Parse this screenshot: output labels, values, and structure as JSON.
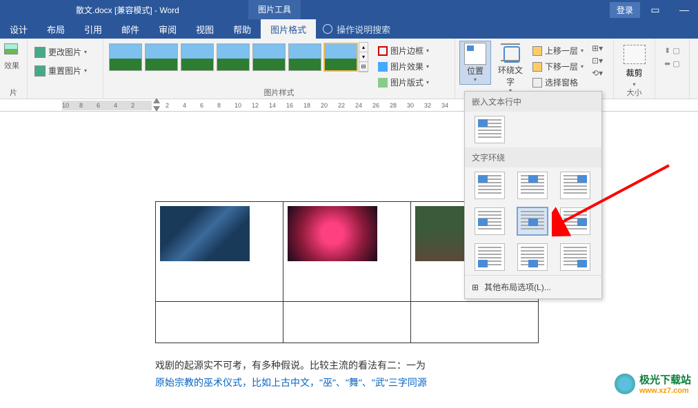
{
  "titlebar": {
    "filename": "散文.docx [兼容模式] - Word",
    "tool_tab": "图片工具",
    "login": "登录"
  },
  "tabs": {
    "design": "设计",
    "layout": "布局",
    "references": "引用",
    "mailings": "邮件",
    "review": "审阅",
    "view": "视图",
    "help": "帮助",
    "picture_format": "图片格式",
    "tell_me": "操作说明搜索"
  },
  "ribbon": {
    "adjust": {
      "change_picture": "更改图片",
      "reset_picture": "重置图片",
      "group_label": "片"
    },
    "styles": {
      "border": "图片边框",
      "effects": "图片效果",
      "layout": "图片版式",
      "group_label": "图片样式"
    },
    "arrange": {
      "position": "位置",
      "wrap_text": "环绕文\n字",
      "bring_forward": "上移一层",
      "send_backward": "下移一层",
      "selection_pane": "选择窗格"
    },
    "crop": {
      "crop": "裁剪",
      "group_label": "大小"
    }
  },
  "dropdown": {
    "inline_header": "嵌入文本行中",
    "wrap_header": "文字环绕",
    "more_options": "其他布局选项(L)..."
  },
  "ruler": [
    "10",
    "8",
    "6",
    "4",
    "2",
    "",
    "2",
    "4",
    "6",
    "8",
    "10",
    "12",
    "14",
    "16",
    "18",
    "20",
    "22",
    "24",
    "26",
    "28",
    "30",
    "32",
    "34"
  ],
  "document": {
    "text_line1": "戏剧的起源实不可考，有多种假说。比较主流的看法有二：一为",
    "text_line2": "原始宗教的巫术仪式，比如上古中文，\"巫\"、\"舞\"、\"武\"三字同源"
  },
  "watermark": {
    "name": "极光下载站",
    "url": "www.xz7.com"
  }
}
